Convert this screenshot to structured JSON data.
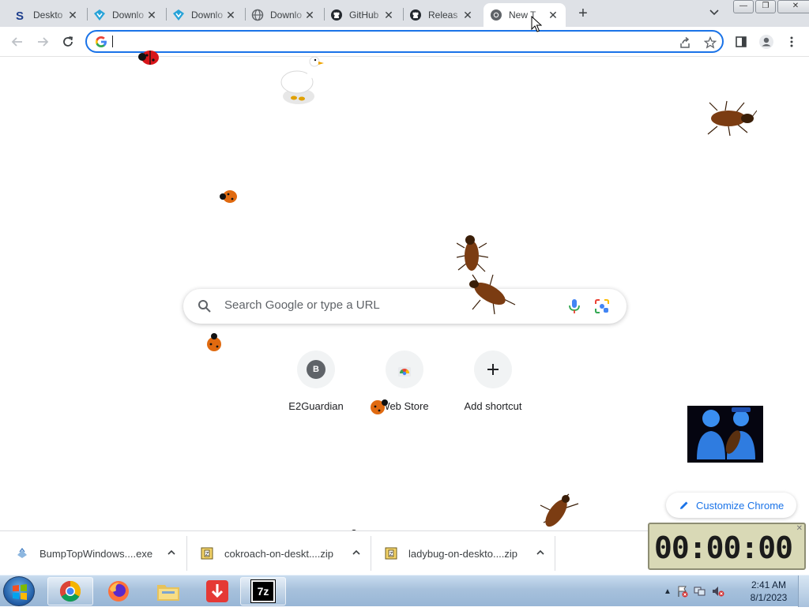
{
  "tabs": [
    {
      "label": "Deskto",
      "icon": "s-logo-icon"
    },
    {
      "label": "Downlo",
      "icon": "download-diamond-icon"
    },
    {
      "label": "Downlo",
      "icon": "download-diamond-icon"
    },
    {
      "label": "Downlo",
      "icon": "globe-icon"
    },
    {
      "label": "GitHub",
      "icon": "github-icon"
    },
    {
      "label": "Releas",
      "icon": "github-icon"
    },
    {
      "label": "New T",
      "icon": "chrome-icon",
      "active": true
    }
  ],
  "window_buttons": {
    "minimize": "—",
    "maximize": "❐",
    "close": "✕"
  },
  "omnibox": {
    "value": "",
    "placeholder": ""
  },
  "search": {
    "placeholder": "Search Google or type a URL"
  },
  "shortcuts": [
    {
      "label": "E2Guardian",
      "initial": "B"
    },
    {
      "label": "Web Store"
    },
    {
      "label": "Add shortcut"
    }
  ],
  "customize": {
    "label": "Customize Chrome"
  },
  "downloads": [
    {
      "name": "BumpTopWindows....exe",
      "icon": "installer-icon"
    },
    {
      "name": "cokroach-on-deskt....zip",
      "icon": "zip-icon"
    },
    {
      "name": "ladybug-on-deskto....zip",
      "icon": "zip-icon"
    }
  ],
  "timer": {
    "display": "00:00:00"
  },
  "taskbar": {
    "apps": [
      "chrome",
      "firefox",
      "file-explorer",
      "downloader",
      "7zip"
    ],
    "sevenzip_label": "7z"
  },
  "clock": {
    "time": "2:41 AM",
    "date": "8/1/2023"
  },
  "colors": {
    "accent": "#1a73e8",
    "tabstrip": "#dee1e6",
    "taskbar": "#a7c1dc"
  }
}
